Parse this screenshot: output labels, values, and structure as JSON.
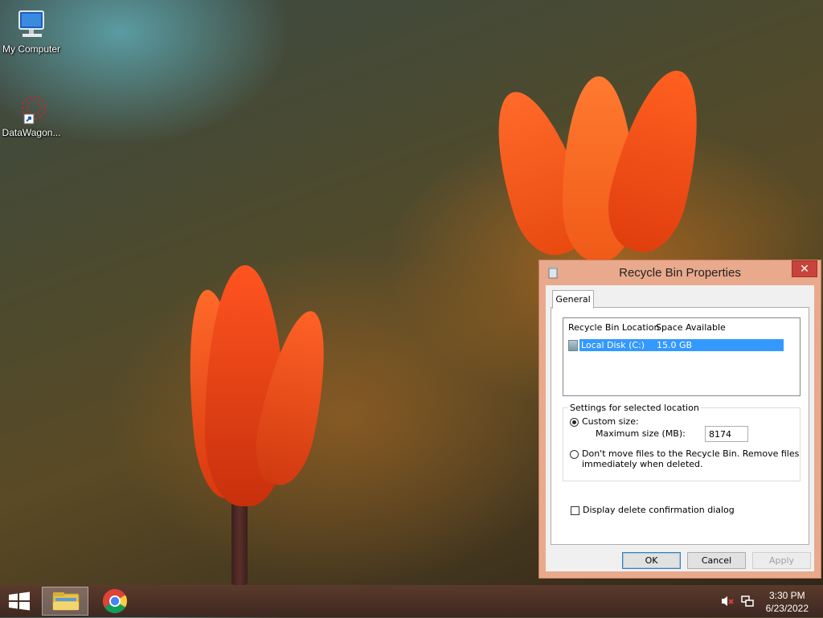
{
  "desktop": {
    "icons": [
      {
        "label": "My Computer",
        "icon": "computer-icon"
      },
      {
        "label": "DataWagon...",
        "icon": "datawagon-shortcut-icon"
      }
    ]
  },
  "dialog": {
    "title": "Recycle Bin Properties",
    "close_glyph": "✕",
    "tabs": [
      {
        "label": "General"
      }
    ],
    "list": {
      "columns": [
        "Recycle Bin Location",
        "Space Available"
      ],
      "rows": [
        {
          "location": "Local Disk (C:)",
          "space": "15.0 GB",
          "selected": true
        }
      ]
    },
    "settings": {
      "group_label": "Settings for selected location",
      "custom_size_label": "Custom size:",
      "max_size_label": "Maximum size (MB):",
      "max_size_value": "8174",
      "no_move_line1": "Don't move files to the Recycle Bin. Remove files",
      "no_move_line2": "immediately when deleted."
    },
    "confirm_label": "Display delete confirmation dialog",
    "buttons": {
      "ok": "OK",
      "cancel": "Cancel",
      "apply": "Apply"
    }
  },
  "taskbar": {
    "time": "3:30 PM",
    "date": "6/23/2022"
  },
  "colors": {
    "dialog_frame": "#e9a98c",
    "selection": "#3399ff",
    "close_button": "#c7433b"
  }
}
